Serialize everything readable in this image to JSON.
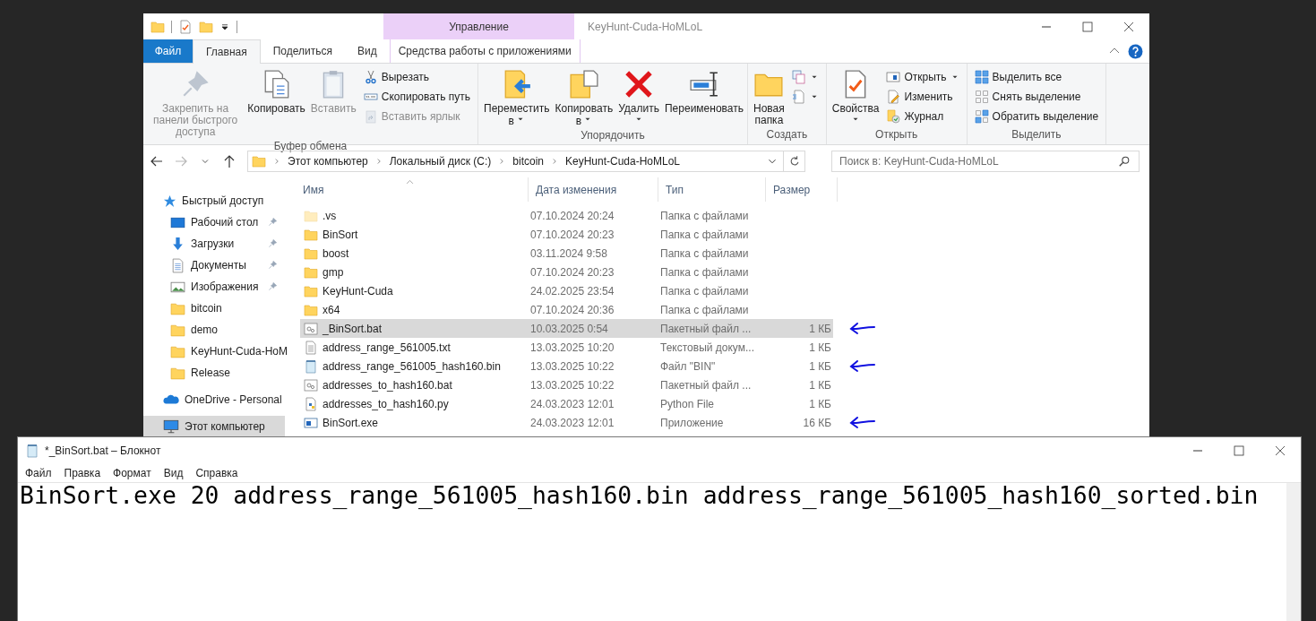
{
  "explorer": {
    "context_header": "Управление",
    "title": "KeyHunt-Cuda-HoMLoL",
    "tabs": [
      {
        "label": "Файл",
        "kind": "file",
        "selected": false
      },
      {
        "label": "Главная",
        "kind": "normal",
        "selected": true
      },
      {
        "label": "Поделиться",
        "kind": "normal",
        "selected": false
      },
      {
        "label": "Вид",
        "kind": "normal",
        "selected": false
      },
      {
        "label": "Средства работы с приложениями",
        "kind": "context",
        "selected": false
      }
    ],
    "ribbon": {
      "groups": [
        {
          "label": "Буфер обмена",
          "items": [
            {
              "kind": "large",
              "label": "Закрепить на панели быстрого доступа",
              "disabled": true,
              "dropdown": false
            },
            {
              "kind": "large",
              "label": "Копировать",
              "disabled": false,
              "dropdown": false
            },
            {
              "kind": "large",
              "label": "Вставить",
              "disabled": true,
              "dropdown": false
            },
            {
              "kind": "small",
              "label": "Вырезать",
              "disabled": false,
              "dropdown": false
            },
            {
              "kind": "small",
              "label": "Скопировать путь",
              "disabled": false,
              "dropdown": false
            },
            {
              "kind": "small",
              "label": "Вставить ярлык",
              "disabled": true,
              "dropdown": false
            }
          ]
        },
        {
          "label": "Упорядочить",
          "items": [
            {
              "kind": "large",
              "label": "Переместить в",
              "disabled": false,
              "dropdown": true
            },
            {
              "kind": "large",
              "label": "Копировать в",
              "disabled": false,
              "dropdown": true
            },
            {
              "kind": "large",
              "label": "Удалить",
              "disabled": false,
              "dropdown": true
            },
            {
              "kind": "large",
              "label": "Переименовать",
              "disabled": false,
              "dropdown": false
            }
          ]
        },
        {
          "label": "Создать",
          "items": [
            {
              "kind": "large",
              "label": "Новая папка",
              "disabled": false,
              "dropdown": false
            },
            {
              "kind": "icon",
              "disabled": false,
              "dropdown": true
            },
            {
              "kind": "icon",
              "disabled": false,
              "dropdown": true
            }
          ]
        },
        {
          "label": "Открыть",
          "items": [
            {
              "kind": "large",
              "label": "Свойства",
              "disabled": false,
              "dropdown": true
            },
            {
              "kind": "small",
              "label": "Открыть",
              "disabled": false,
              "dropdown": true
            },
            {
              "kind": "small",
              "label": "Изменить",
              "disabled": false,
              "dropdown": false
            },
            {
              "kind": "small",
              "label": "Журнал",
              "disabled": false,
              "dropdown": false
            }
          ]
        },
        {
          "label": "Выделить",
          "items": [
            {
              "kind": "small",
              "label": "Выделить все",
              "disabled": false,
              "dropdown": false
            },
            {
              "kind": "small",
              "label": "Снять выделение",
              "disabled": false,
              "dropdown": false
            },
            {
              "kind": "small",
              "label": "Обратить выделение",
              "disabled": false,
              "dropdown": false
            }
          ]
        }
      ]
    },
    "nav": [
      {
        "kind": "back",
        "disabled": false
      },
      {
        "kind": "forward",
        "disabled": true
      },
      {
        "kind": "recent",
        "disabled": false
      },
      {
        "kind": "up",
        "disabled": false
      }
    ],
    "address": {
      "segments": [
        "Этот компьютер",
        "Локальный диск (C:)",
        "bitcoin",
        "KeyHunt-Cuda-HoMLoL"
      ]
    },
    "search": {
      "placeholder": "Поиск в: KeyHunt-Cuda-HoMLoL"
    },
    "sidebar": {
      "items": [
        {
          "label": "Быстрый доступ",
          "kind": "star",
          "selected": false,
          "children": [
            {
              "label": "Рабочий стол",
              "kind": "desktop",
              "pinned": true,
              "selected": false
            },
            {
              "label": "Загрузки",
              "kind": "download",
              "pinned": true,
              "selected": false
            },
            {
              "label": "Документы",
              "kind": "document",
              "pinned": true,
              "selected": false
            },
            {
              "label": "Изображения",
              "kind": "pictures",
              "pinned": true,
              "selected": false
            },
            {
              "label": "bitcoin",
              "kind": "folder",
              "pinned": false,
              "selected": false
            },
            {
              "label": "demo",
              "kind": "folder",
              "pinned": false,
              "selected": false
            },
            {
              "label": "KeyHunt-Cuda-HoM",
              "kind": "folder",
              "pinned": false,
              "selected": false
            },
            {
              "label": "Release",
              "kind": "folder",
              "pinned": false,
              "selected": false
            }
          ]
        },
        {
          "label": "OneDrive - Personal",
          "kind": "cloud",
          "selected": false
        },
        {
          "label": "Этот компьютер",
          "kind": "computer",
          "selected": true
        }
      ]
    },
    "columns": [
      {
        "label": "Имя",
        "sorted": true
      },
      {
        "label": "Дата изменения",
        "sorted": false
      },
      {
        "label": "Тип",
        "sorted": false
      },
      {
        "label": "Размер",
        "sorted": false
      }
    ],
    "files": [
      {
        "name": ".vs",
        "date": "07.10.2024 20:24",
        "type": "Папка с файлами",
        "kind": "folder",
        "hidden": true,
        "selected": false,
        "marked": false
      },
      {
        "name": "BinSort",
        "date": "07.10.2024 20:23",
        "type": "Папка с файлами",
        "kind": "folder",
        "hidden": false,
        "selected": false,
        "marked": false
      },
      {
        "name": "boost",
        "date": "03.11.2024 9:58",
        "type": "Папка с файлами",
        "kind": "folder",
        "hidden": false,
        "selected": false,
        "marked": false
      },
      {
        "name": "gmp",
        "date": "07.10.2024 20:23",
        "type": "Папка с файлами",
        "kind": "folder",
        "hidden": false,
        "selected": false,
        "marked": false
      },
      {
        "name": "KeyHunt-Cuda",
        "date": "24.02.2025 23:54",
        "type": "Папка с файлами",
        "kind": "folder",
        "hidden": false,
        "selected": false,
        "marked": false
      },
      {
        "name": "x64",
        "date": "07.10.2024 20:36",
        "type": "Папка с файлами",
        "kind": "folder",
        "hidden": false,
        "selected": false,
        "marked": false
      },
      {
        "name": "_BinSort.bat",
        "date": "10.03.2025 0:54",
        "type": "Пакетный файл ...",
        "size": "1 КБ",
        "kind": "bat",
        "hidden": false,
        "selected": true,
        "marked": true
      },
      {
        "name": "address_range_561005.txt",
        "date": "13.03.2025 10:20",
        "type": "Текстовый докум...",
        "size": "1 КБ",
        "kind": "txt",
        "hidden": false,
        "selected": false,
        "marked": false
      },
      {
        "name": "address_range_561005_hash160.bin",
        "date": "13.03.2025 10:22",
        "type": "Файл \"BIN\"",
        "size": "1 КБ",
        "kind": "bin",
        "hidden": false,
        "selected": false,
        "marked": true
      },
      {
        "name": "addresses_to_hash160.bat",
        "date": "13.03.2025 10:22",
        "type": "Пакетный файл ...",
        "size": "1 КБ",
        "kind": "bat",
        "hidden": false,
        "selected": false,
        "marked": false
      },
      {
        "name": "addresses_to_hash160.py",
        "date": "24.03.2023 12:01",
        "type": "Python File",
        "size": "1 КБ",
        "kind": "py",
        "hidden": false,
        "selected": false,
        "marked": false
      },
      {
        "name": "BinSort.exe",
        "date": "24.03.2023 12:01",
        "type": "Приложение",
        "size": "16 КБ",
        "kind": "exe",
        "hidden": false,
        "selected": false,
        "marked": true
      }
    ]
  },
  "notepad": {
    "title": "*_BinSort.bat – Блокнот",
    "menu": [
      "Файл",
      "Правка",
      "Формат",
      "Вид",
      "Справка"
    ],
    "text": "BinSort.exe 20 address_range_561005_hash160.bin address_range_561005_hash160_sorted.bin"
  }
}
